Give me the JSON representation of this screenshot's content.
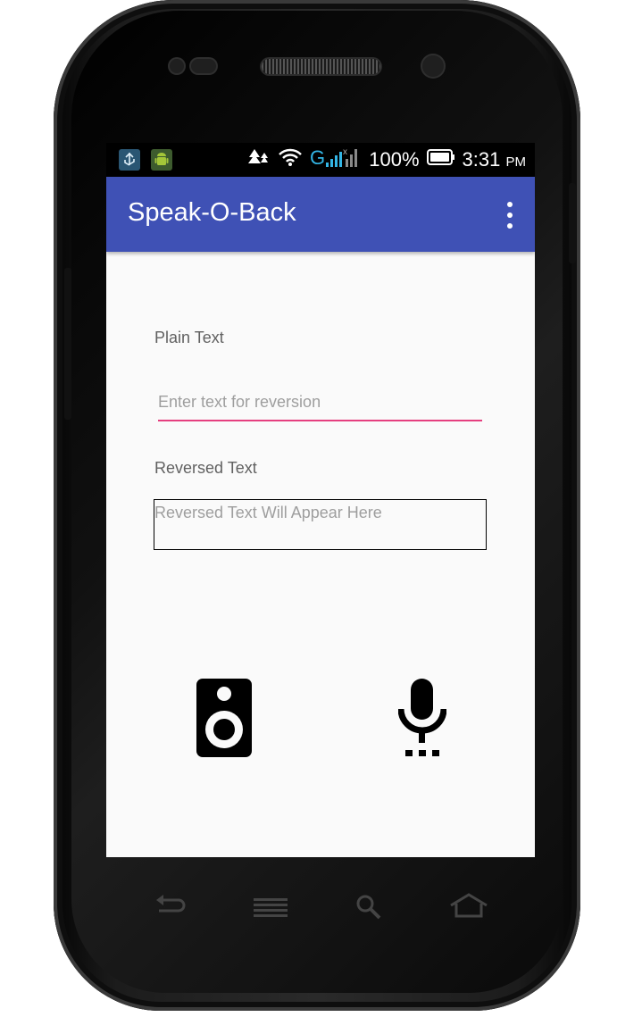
{
  "status_bar": {
    "battery_percent": "100%",
    "time": "3:31",
    "time_suffix": "PM"
  },
  "app_bar": {
    "title": "Speak-O-Back",
    "overflow_icon": "more-vert-icon"
  },
  "form": {
    "plain_text_label": "Plain Text",
    "plain_text_value": "",
    "plain_text_placeholder": "Enter text for reversion",
    "reversed_text_label": "Reversed Text",
    "reversed_text_value": "Reversed Text Will Appear Here"
  },
  "actions": {
    "speak_icon": "speaker-icon",
    "listen_icon": "microphone-icon"
  },
  "colors": {
    "primary": "#3f51b5",
    "accent": "#e53f7f",
    "background": "#fafafa"
  }
}
